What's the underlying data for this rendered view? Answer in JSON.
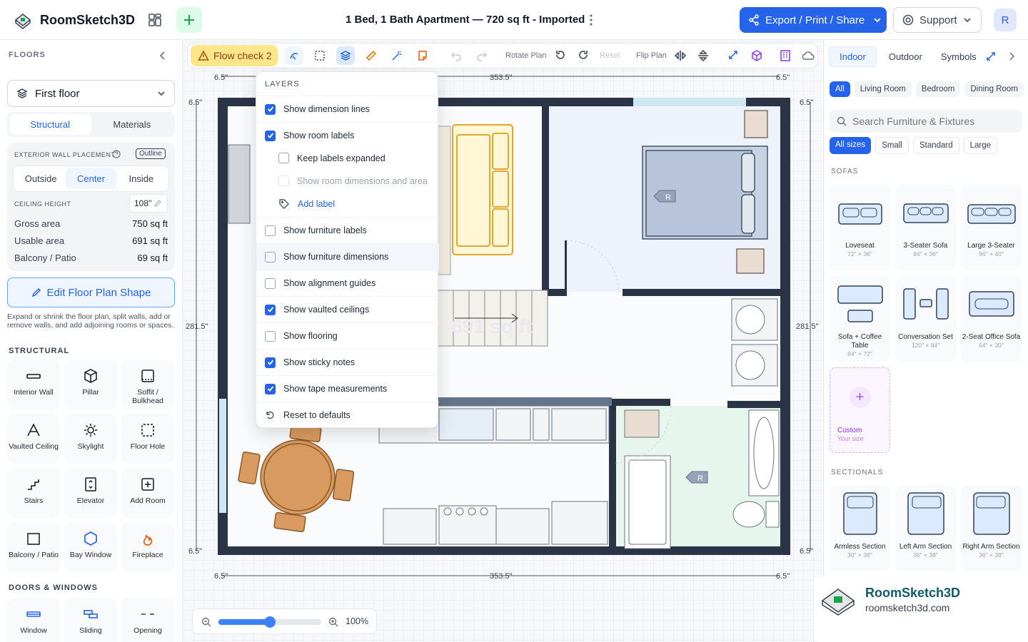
{
  "app": {
    "name": "RoomSketch3D",
    "doc_title": "1 Bed, 1 Bath Apartment — 720 sq ft - Imported",
    "export_label": "Export / Print / Share",
    "support_label": "Support",
    "avatar_initial": "R"
  },
  "left": {
    "floors_title": "FLOORS",
    "floor_selected": "First floor",
    "tabs": [
      "Structural",
      "Materials"
    ],
    "wall_placement_label": "EXTERIOR WALL PLACEMENT",
    "outline_badge": "Outline",
    "placement_options": [
      "Outside",
      "Center",
      "Inside"
    ],
    "ceiling_label": "CEILING HEIGHT",
    "ceiling_value": "108\"",
    "stats": [
      {
        "label": "Gross area",
        "value": "750 sq ft"
      },
      {
        "label": "Usable area",
        "value": "691 sq ft"
      },
      {
        "label": "Balcony / Patio",
        "value": "69 sq ft"
      }
    ],
    "edit_shape_label": "Edit Floor Plan Shape",
    "edit_shape_help": "Expand or shrink the floor plan, split walls, add or remove walls, and add adjoining rooms or spaces.",
    "structural_title": "STRUCTURAL",
    "structural_tools": [
      "Interior Wall",
      "Pillar",
      "Soffit / Bulkhead",
      "Vaulted Ceiling",
      "Skylight",
      "Floor Hole",
      "Stairs",
      "Elevator",
      "Add Room",
      "Balcony / Patio",
      "Bay Window",
      "Fireplace"
    ],
    "doors_title": "DOORS & WINDOWS",
    "door_tools": [
      "Window",
      "Sliding",
      "Opening"
    ]
  },
  "toolbar": {
    "flow_check": "Flow check 2",
    "rotate_plan": "Rotate Plan",
    "reset": "Reset",
    "flip_plan": "Flip Plan"
  },
  "layers": {
    "title": "LAYERS",
    "items": [
      {
        "label": "Show dimension lines",
        "checked": true
      },
      {
        "label": "Show room labels",
        "checked": true
      },
      {
        "label": "Keep labels expanded",
        "checked": false
      },
      {
        "label": "Show room dimensions and area",
        "checked": false
      },
      {
        "label": "Add label"
      },
      {
        "label": "Show furniture labels",
        "checked": false
      },
      {
        "label": "Show furniture dimensions",
        "checked": false
      },
      {
        "label": "Show alignment guides",
        "checked": false
      },
      {
        "label": "Show vaulted ceilings",
        "checked": true
      },
      {
        "label": "Show flooring",
        "checked": false
      },
      {
        "label": "Show sticky notes",
        "checked": true
      },
      {
        "label": "Show tape measurements",
        "checked": true
      },
      {
        "label": "Reset to defaults"
      }
    ]
  },
  "plan": {
    "dims": {
      "top_left": "6.5\"",
      "top_mid": "353.5\"",
      "top_right": "6.5\"",
      "side_top": "6.5\"",
      "side_mid": "281.5\"",
      "side_bottom": "6.5\"",
      "right_top": "6.5\"",
      "right_mid": "281.5\"",
      "right_bottom": "6.5\"",
      "bottom_left": "6.5\"",
      "bottom_mid": "353.5\"",
      "bottom_right": "6.5\""
    },
    "room_tag": "R",
    "watermark": "691 sq ft"
  },
  "zoom": {
    "value": "100%",
    "level": 0.5
  },
  "right": {
    "tabs": [
      "Indoor",
      "Outdoor",
      "Symbols"
    ],
    "rooms": [
      "All",
      "Living Room",
      "Bedroom",
      "Dining Room"
    ],
    "search_placeholder": "Search Furniture & Fixtures",
    "sizes": [
      "All sizes",
      "Small",
      "Standard",
      "Large"
    ],
    "sofas_title": "SOFAS",
    "sofas": [
      {
        "name": "Loveseat",
        "size": "72\" × 36\""
      },
      {
        "name": "3-Seater Sofa",
        "size": "84\" × 38\""
      },
      {
        "name": "Large 3-Seater",
        "size": "96\" × 40\""
      },
      {
        "name": "Sofa + Coffee Table",
        "size": "84\" × 72\""
      },
      {
        "name": "Conversation Set",
        "size": "120\" × 84\""
      },
      {
        "name": "2-Seat Office Sofa",
        "size": "54\" × 30\""
      }
    ],
    "custom": {
      "title": "Custom",
      "sub": "Your size"
    },
    "sectionals_title": "SECTIONALS",
    "sectionals": [
      {
        "name": "Armless Section",
        "size": "30\" × 38\""
      },
      {
        "name": "Left Arm Section",
        "size": "36\" × 38\""
      },
      {
        "name": "Right Arm Section",
        "size": "36\" × 38\""
      }
    ]
  },
  "brand": {
    "name": "RoomSketch3D",
    "url": "roomsketch3d.com"
  }
}
